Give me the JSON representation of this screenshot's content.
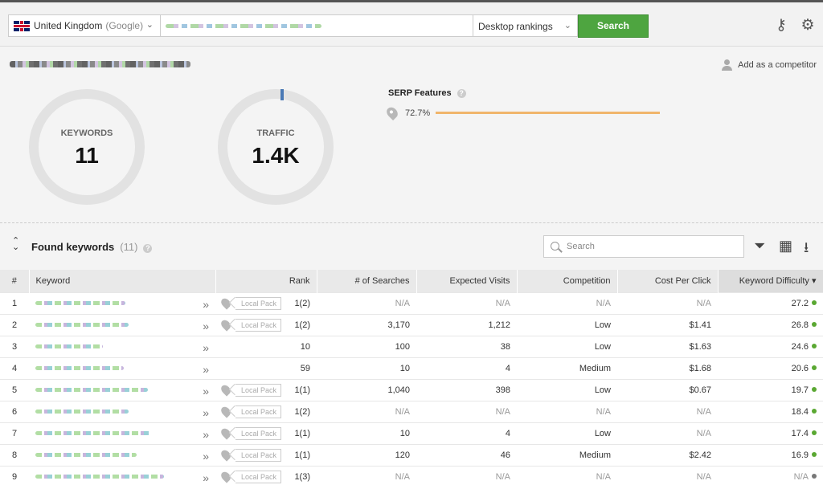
{
  "topbar": {
    "country": "United Kingdom",
    "engine": "(Google)",
    "device": "Desktop rankings",
    "search_label": "Search"
  },
  "summary": {
    "competitor_label": "Add as a competitor",
    "keywords_label": "KEYWORDS",
    "keywords_value": "11",
    "traffic_label": "TRAFFIC",
    "traffic_value": "1.4K",
    "serp_title": "SERP Features",
    "serp_percent": "72.7%"
  },
  "toolbar": {
    "title": "Found keywords",
    "count": "(11)",
    "search_placeholder": "Search"
  },
  "table": {
    "headers": [
      "#",
      "Keyword",
      "Rank",
      "# of Searches",
      "Expected Visits",
      "Competition",
      "Cost Per Click",
      "Keyword Difficulty ▾"
    ],
    "rows": [
      {
        "index": "1",
        "local": "Local Pack",
        "rank": "1(2)",
        "searches": "N/A",
        "visits": "N/A",
        "competition": "N/A",
        "cpc": "N/A",
        "difficulty": "27.2",
        "dot": "#5aa832"
      },
      {
        "index": "2",
        "local": "Local Pack",
        "rank": "1(2)",
        "searches": "3,170",
        "visits": "1,212",
        "competition": "Low",
        "cpc": "$1.41",
        "difficulty": "26.8",
        "dot": "#5aa832"
      },
      {
        "index": "3",
        "local": "",
        "rank": "10",
        "searches": "100",
        "visits": "38",
        "competition": "Low",
        "cpc": "$1.63",
        "difficulty": "24.6",
        "dot": "#5aa832"
      },
      {
        "index": "4",
        "local": "",
        "rank": "59",
        "searches": "10",
        "visits": "4",
        "competition": "Medium",
        "cpc": "$1.68",
        "difficulty": "20.6",
        "dot": "#5aa832"
      },
      {
        "index": "5",
        "local": "Local Pack",
        "rank": "1(1)",
        "searches": "1,040",
        "visits": "398",
        "competition": "Low",
        "cpc": "$0.67",
        "difficulty": "19.7",
        "dot": "#5aa832"
      },
      {
        "index": "6",
        "local": "Local Pack",
        "rank": "1(2)",
        "searches": "N/A",
        "visits": "N/A",
        "competition": "N/A",
        "cpc": "N/A",
        "difficulty": "18.4",
        "dot": "#5aa832"
      },
      {
        "index": "7",
        "local": "Local Pack",
        "rank": "1(1)",
        "searches": "10",
        "visits": "4",
        "competition": "Low",
        "cpc": "N/A",
        "difficulty": "17.4",
        "dot": "#5aa832"
      },
      {
        "index": "8",
        "local": "Local Pack",
        "rank": "1(1)",
        "searches": "120",
        "visits": "46",
        "competition": "Medium",
        "cpc": "$2.42",
        "difficulty": "16.9",
        "dot": "#5aa832"
      },
      {
        "index": "9",
        "local": "Local Pack",
        "rank": "1(3)",
        "searches": "N/A",
        "visits": "N/A",
        "competition": "N/A",
        "cpc": "N/A",
        "difficulty": "N/A",
        "dot": "#777777"
      }
    ]
  }
}
